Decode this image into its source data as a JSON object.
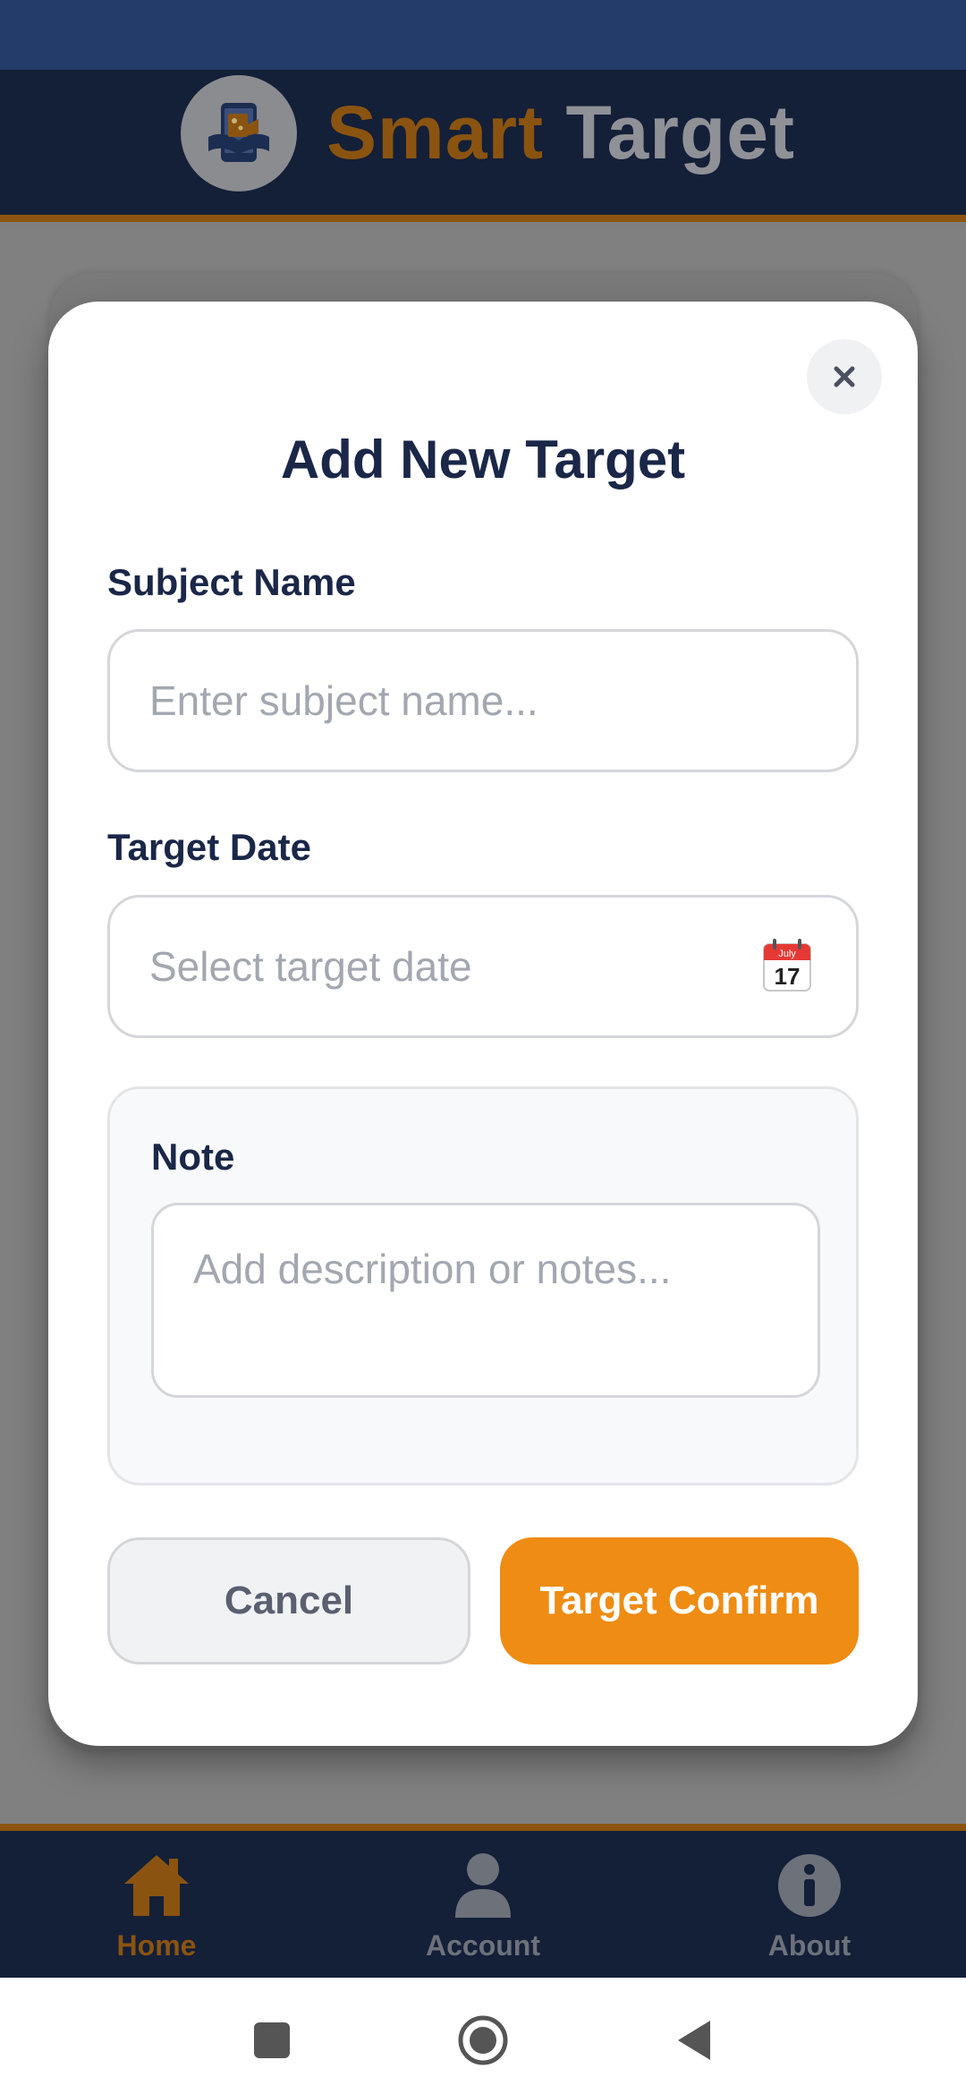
{
  "app": {
    "title_part1": "Smart",
    "title_part2": "Target",
    "colors": {
      "header_bg": "#141f38",
      "accent": "#ef8c13",
      "overlay": "#808080"
    }
  },
  "modal": {
    "title": "Add New Target",
    "close_icon": "close-icon",
    "subject_label": "Subject Name",
    "subject_placeholder": "Enter subject name...",
    "subject_value": "",
    "date_label": "Target Date",
    "date_placeholder": "Select target date",
    "date_value": "",
    "calendar_month": "July",
    "calendar_day": "17",
    "note_label": "Note",
    "note_placeholder": "Add description or notes...",
    "note_value": "",
    "cancel_label": "Cancel",
    "confirm_label": "Target Confirm"
  },
  "bottom_nav": {
    "items": [
      {
        "label": "Home",
        "icon": "home-icon",
        "active": true
      },
      {
        "label": "Account",
        "icon": "user-icon",
        "active": false
      },
      {
        "label": "About",
        "icon": "info-icon",
        "active": false
      }
    ]
  },
  "system_nav": {
    "icons": [
      "recents-icon",
      "home-circle-icon",
      "back-icon"
    ]
  }
}
